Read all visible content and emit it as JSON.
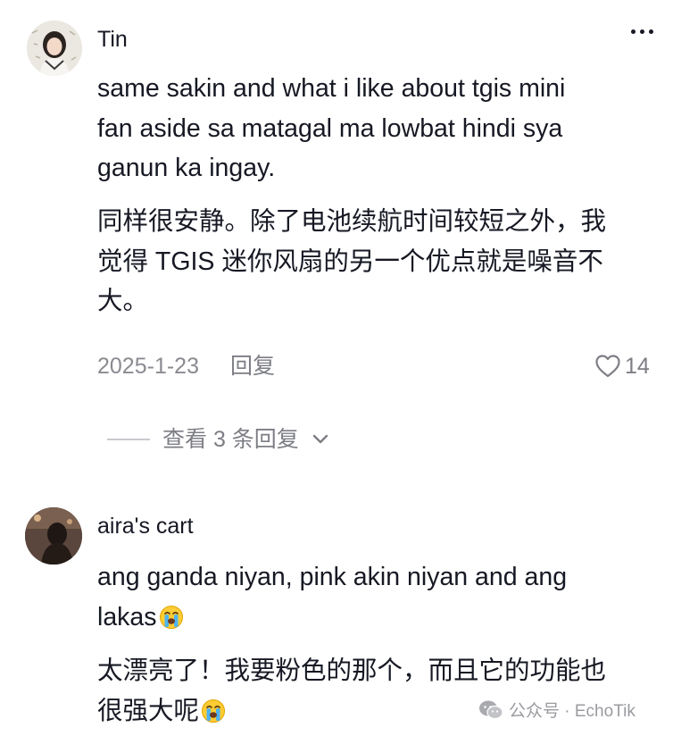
{
  "comments": [
    {
      "username": "Tin",
      "text_lines": [
        "same sakin and what i like about tgis mini",
        "fan aside sa matagal ma lowbat hindi sya",
        "ganun ka ingay."
      ],
      "translation_lines": [
        "同样很安静。除了电池续航时间较短之外，我",
        "觉得 TGIS 迷你风扇的另一个优点就是噪音不",
        "大。"
      ],
      "date": "2025-1-23",
      "reply_label": "回复",
      "like_count": "14",
      "view_replies_label": "查看 3 条回复"
    },
    {
      "username": "aira's cart",
      "text_lines": [
        "ang ganda niyan, pink akin niyan and ang",
        "lakas"
      ],
      "translation_lines": [
        "太漂亮了！我要粉色的那个，而且它的功能也",
        "很强大呢"
      ],
      "emoji": "loudly-crying-face"
    }
  ],
  "watermark": {
    "text": "公众号 · EchoTik",
    "icon": "wechat-icon"
  },
  "colors": {
    "text_primary": "#161823",
    "text_secondary": "#8a8b91",
    "divider": "#c9cacf"
  }
}
